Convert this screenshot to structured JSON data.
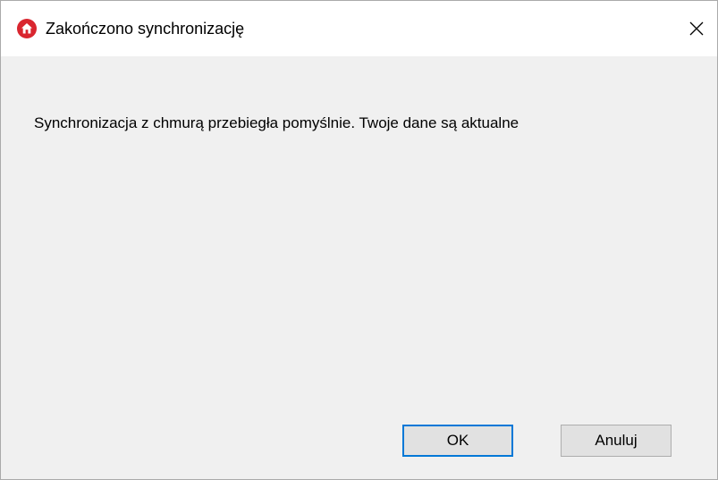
{
  "window": {
    "title": "Zakończono synchronizację",
    "app_icon": "home-icon",
    "close_icon": "close-icon"
  },
  "dialog": {
    "message": "Synchronizacja z chmurą przebiegła pomyślnie. Twoje dane są aktualne",
    "ok_label": "OK",
    "cancel_label": "Anuluj"
  },
  "colors": {
    "icon_red": "#d9262f",
    "focus_border": "#0078d7",
    "button_face": "#e1e1e1",
    "dialog_background": "#f0f0f0"
  }
}
